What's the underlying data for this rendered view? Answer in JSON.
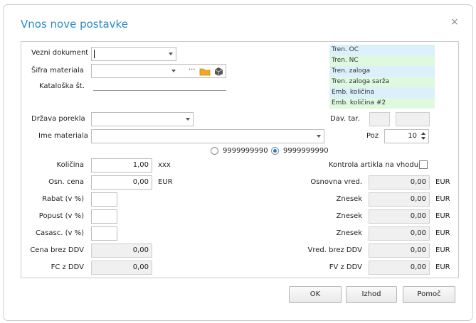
{
  "dialog": {
    "title": "Vnos nove postavke",
    "close_glyph": "×"
  },
  "fields": {
    "vezni_dokument": {
      "label": "Vezni dokument",
      "value": ""
    },
    "sifra_materiala": {
      "label": "Šifra materiala",
      "value": "",
      "ellipsis": "···"
    },
    "kataloska": {
      "label": "Kataloška št.",
      "value": ""
    },
    "drzava": {
      "label": "Država porekla",
      "value": ""
    },
    "ime": {
      "label": "Ime materiala",
      "value": ""
    },
    "dav_tar": {
      "label": "Dav. tar."
    },
    "poz": {
      "label": "Poz",
      "value": "10"
    },
    "radio1": "9999999990",
    "radio2": "9999999990",
    "kolicina": {
      "label": "Količina",
      "value": "1,00",
      "unit": "xxx"
    },
    "osn_cena": {
      "label": "Osn. cena",
      "value": "0,00",
      "unit": "EUR"
    },
    "rabat": {
      "label": "Rabat (v %)"
    },
    "popust": {
      "label": "Popust (v %)"
    },
    "casasc": {
      "label": "Casasc. (v %)"
    },
    "cena_brez": {
      "label": "Cena brez DDV",
      "value": "0,00"
    },
    "fc": {
      "label": "FC z DDV",
      "value": "0,00"
    },
    "kontrola": {
      "label": "Kontrola artikla na vhodu"
    },
    "osnovna": {
      "label": "Osnovna vred.",
      "value": "0,00",
      "unit": "EUR"
    },
    "znesek1": {
      "label": "Znesek",
      "value": "0,00",
      "unit": "EUR"
    },
    "znesek2": {
      "label": "Znesek",
      "value": "0,00",
      "unit": "EUR"
    },
    "znesek3": {
      "label": "Znesek",
      "value": "0,00",
      "unit": "EUR"
    },
    "vred_brez": {
      "label": "Vred. brez DDV",
      "value": "0,00",
      "unit": "EUR"
    },
    "fv": {
      "label": "FV z DDV",
      "value": "0,00",
      "unit": "EUR"
    }
  },
  "stock_list": [
    "Tren. OC",
    "Tren. NC",
    "Tren. zaloga",
    "Tren. zaloga sarža",
    "Emb. količina",
    "Emb. količina #2"
  ],
  "buttons": {
    "ok": "OK",
    "izhod": "Izhod",
    "pomoc": "Pomoč"
  },
  "colors": {
    "title": "#2a8bc9",
    "list_blue": "#dcf0fc",
    "list_green": "#dff8e0",
    "folder": "#f2a91d"
  }
}
